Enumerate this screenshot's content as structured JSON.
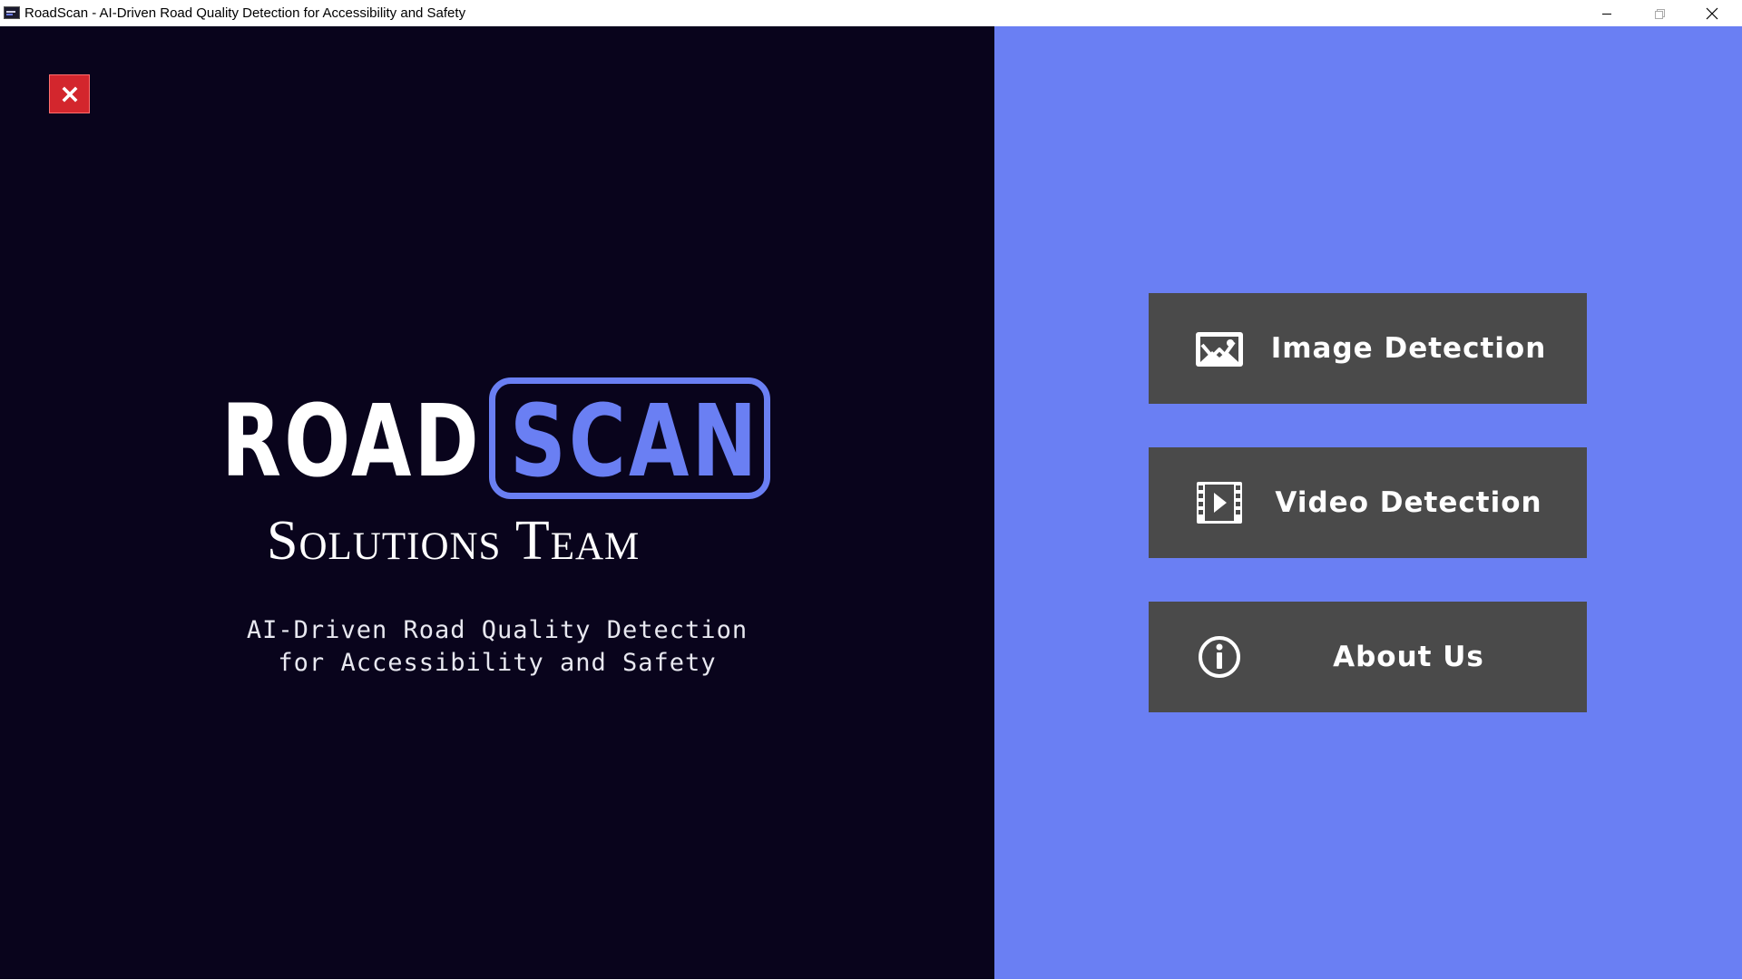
{
  "window": {
    "title": "RoadScan - AI-Driven Road Quality Detection for Accessibility and Safety",
    "controls": [
      "minimize-icon",
      "maximize-icon",
      "close-icon"
    ]
  },
  "left_panel": {
    "close_icon": "close-icon",
    "logo": {
      "word1": "ROAD",
      "word2": "SCAN",
      "subtitle": "Solutions Team"
    },
    "tagline_line1": "AI-Driven Road Quality Detection",
    "tagline_line2": "for Accessibility and Safety"
  },
  "menu": {
    "image_detection": {
      "label": "Image Detection",
      "icon": "image-icon"
    },
    "video_detection": {
      "label": "Video Detection",
      "icon": "video-icon"
    },
    "about_us": {
      "label": "About Us",
      "icon": "info-icon"
    }
  },
  "colors": {
    "left_background": "#09041c",
    "right_background": "#6a7ff3",
    "button_background": "#4a4a4a",
    "close_button": "#d3262d",
    "accent": "#6a7ff3"
  }
}
